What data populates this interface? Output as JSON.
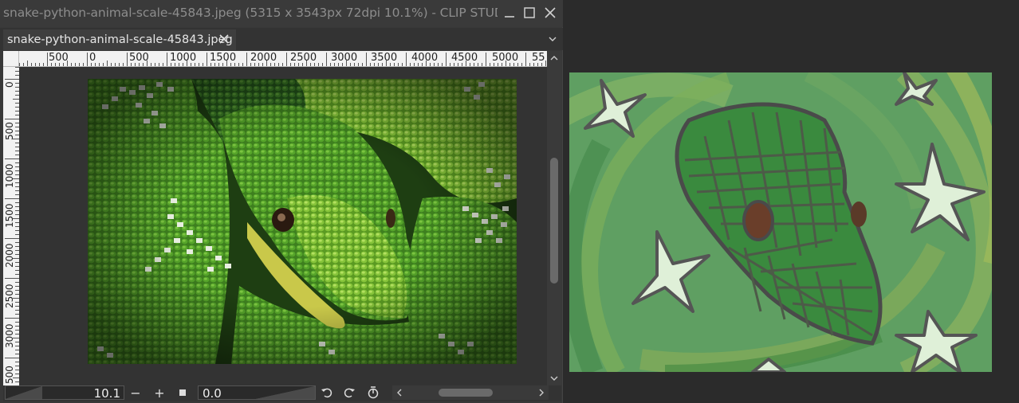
{
  "window": {
    "title": "snake-python-animal-scale-45843.jpeg (5315 x 3543px 72dpi 10.1%)  - CLIP STUDIO PAINT",
    "controls": [
      "minimize-icon",
      "maximize-icon",
      "close-icon"
    ]
  },
  "tab": {
    "label": "snake-python-animal-scale-45843.jpeg",
    "close_icon": "close-icon",
    "menu_icon": "chevron-down-icon"
  },
  "ruler": {
    "horizontal": [
      "500",
      "0",
      "500",
      "1000",
      "1500",
      "2000",
      "2500",
      "3000",
      "3500",
      "4000",
      "4500",
      "5000",
      "55"
    ],
    "vertical": [
      "0",
      "500",
      "1000",
      "1500",
      "2000",
      "2500",
      "3000",
      "500"
    ]
  },
  "toolbar": {
    "zoom_value": "10.1",
    "zoom_out_label": "−",
    "zoom_in_label": "+",
    "fit_icon": "square-icon",
    "angle_value": "0.0",
    "rotate_left_icon": "rotate-left-icon",
    "rotate_right_icon": "rotate-right-icon",
    "reset_rotation_icon": "reset-rotation-icon",
    "scroll_left_icon": "chevron-left-icon",
    "scroll_right_icon": "chevron-right-icon"
  },
  "scrollbar": {
    "up_icon": "chevron-up-icon",
    "down_icon": "chevron-down-icon"
  },
  "colors": {
    "background": "#2b2b2b",
    "panel": "#383838",
    "ruler": "#f2f2f2",
    "snake_green": "#3f8a2a",
    "drawing_green": "#5a9e5e"
  }
}
